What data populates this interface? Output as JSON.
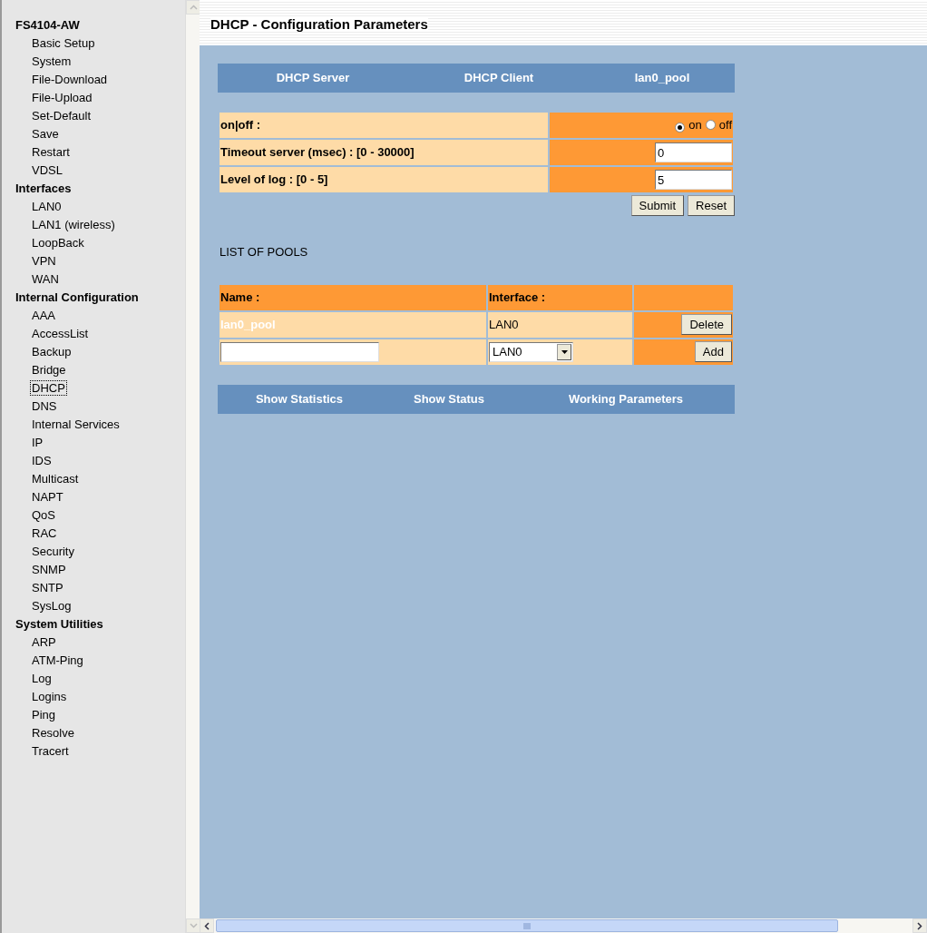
{
  "sidebar": {
    "groups": [
      {
        "heading": "FS4104-AW",
        "items": [
          {
            "label": "Basic Setup",
            "selected": false
          },
          {
            "label": "System",
            "selected": false
          },
          {
            "label": "File-Download",
            "selected": false
          },
          {
            "label": "File-Upload",
            "selected": false
          },
          {
            "label": "Set-Default",
            "selected": false
          },
          {
            "label": "Save",
            "selected": false
          },
          {
            "label": "Restart",
            "selected": false
          },
          {
            "label": "VDSL",
            "selected": false
          }
        ]
      },
      {
        "heading": "Interfaces",
        "items": [
          {
            "label": "LAN0",
            "selected": false
          },
          {
            "label": "LAN1 (wireless)",
            "selected": false
          },
          {
            "label": "LoopBack",
            "selected": false
          },
          {
            "label": "VPN",
            "selected": false
          },
          {
            "label": "WAN",
            "selected": false
          }
        ]
      },
      {
        "heading": "Internal Configuration",
        "items": [
          {
            "label": "AAA",
            "selected": false
          },
          {
            "label": "AccessList",
            "selected": false
          },
          {
            "label": "Backup",
            "selected": false
          },
          {
            "label": "Bridge",
            "selected": false
          },
          {
            "label": "DHCP",
            "selected": true
          },
          {
            "label": "DNS",
            "selected": false
          },
          {
            "label": "Internal Services",
            "selected": false
          },
          {
            "label": "IP",
            "selected": false
          },
          {
            "label": "IDS",
            "selected": false
          },
          {
            "label": "Multicast",
            "selected": false
          },
          {
            "label": "NAPT",
            "selected": false
          },
          {
            "label": "QoS",
            "selected": false
          },
          {
            "label": "RAC",
            "selected": false
          },
          {
            "label": "Security",
            "selected": false
          },
          {
            "label": "SNMP",
            "selected": false
          },
          {
            "label": "SNTP",
            "selected": false
          },
          {
            "label": "SysLog",
            "selected": false
          }
        ]
      },
      {
        "heading": "System Utilities",
        "items": [
          {
            "label": "ARP",
            "selected": false
          },
          {
            "label": "ATM-Ping",
            "selected": false
          },
          {
            "label": "Log",
            "selected": false
          },
          {
            "label": "Logins",
            "selected": false
          },
          {
            "label": "Ping",
            "selected": false
          },
          {
            "label": "Resolve",
            "selected": false
          },
          {
            "label": "Tracert",
            "selected": false
          }
        ]
      }
    ]
  },
  "page": {
    "title": "DHCP - Configuration Parameters",
    "top_nav": [
      "DHCP Server",
      "DHCP Client",
      "lan0_pool"
    ],
    "settings": [
      {
        "kind": "radio",
        "label": "on|off :",
        "options": [
          {
            "label": "on",
            "selected": true
          },
          {
            "label": "off",
            "selected": false
          }
        ]
      },
      {
        "kind": "input",
        "label": "Timeout server (msec) : [0 - 30000]",
        "value": "0"
      },
      {
        "kind": "input",
        "label": "Level of log : [0 - 5]",
        "value": "5"
      }
    ],
    "buttons": [
      "Submit",
      "Reset"
    ],
    "pools": {
      "heading": "LIST OF POOLS",
      "columns": [
        "Name :",
        "Interface :"
      ],
      "rows": [
        {
          "name": "lan0_pool",
          "interface": "LAN0",
          "action": "Delete"
        }
      ],
      "new_row": {
        "interface": "LAN0",
        "action": "Add"
      }
    },
    "bottom_nav": [
      "Show Statistics",
      "Show Status",
      "Working Parameters"
    ]
  }
}
